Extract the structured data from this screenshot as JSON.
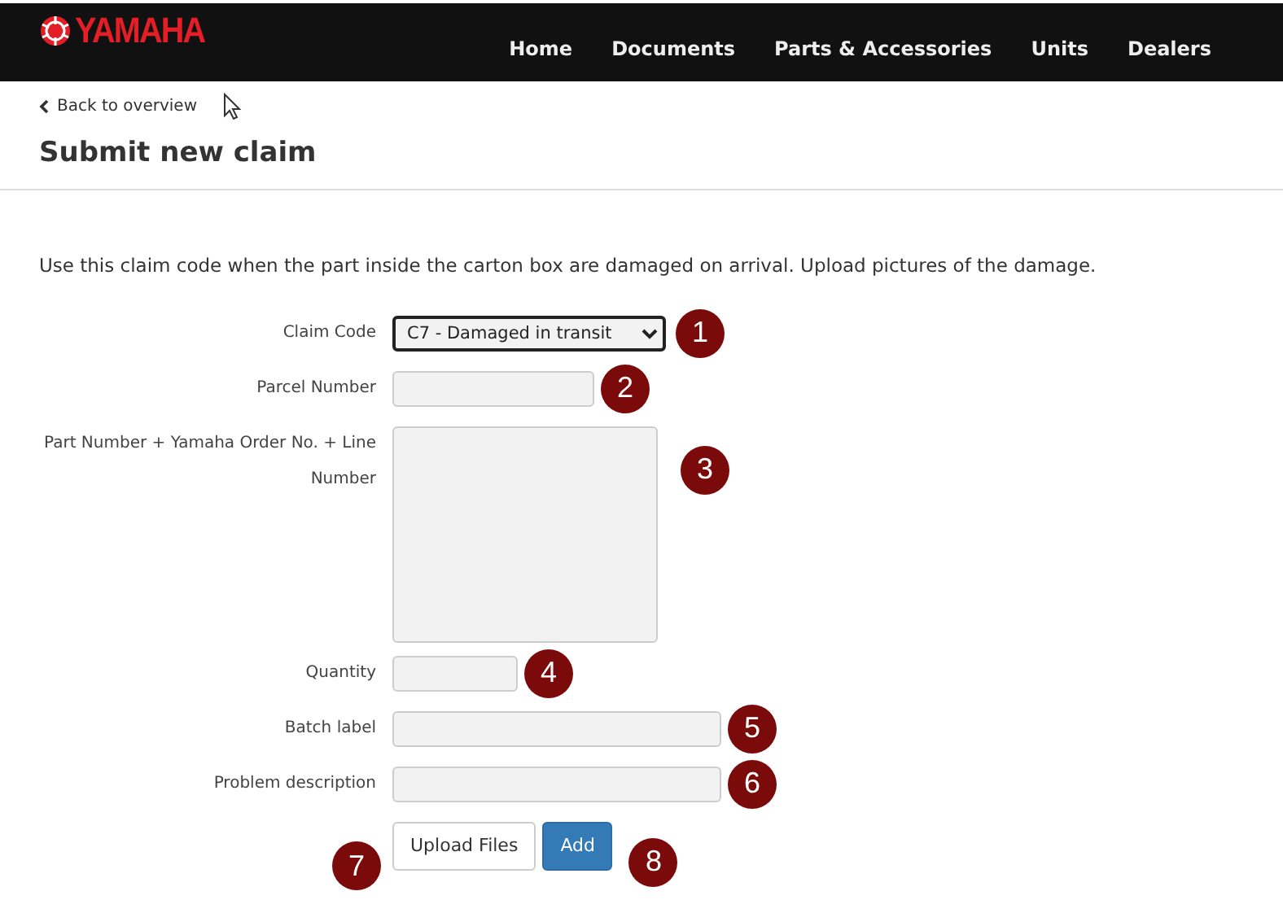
{
  "brand": {
    "name": "YAMAHA"
  },
  "nav": [
    {
      "label": "Home"
    },
    {
      "label": "Documents"
    },
    {
      "label": "Parts & Accessories"
    },
    {
      "label": "Units"
    },
    {
      "label": "Dealers"
    }
  ],
  "back_link": {
    "label": "Back to overview"
  },
  "page_title": "Submit new claim",
  "description": "Use this claim code when the part inside the carton box are damaged on arrival. Upload pictures of the damage.",
  "fields": [
    {
      "label": "Claim Code",
      "kind": "select",
      "value": "C7 - Damaged in transit",
      "marker": "1"
    },
    {
      "label": "Parcel Number",
      "kind": "code",
      "marker": "2"
    },
    {
      "label": "Part Number + Yamaha Order No. + Line Number",
      "kind": "textarea",
      "marker": "3"
    },
    {
      "label": "Quantity",
      "kind": "number",
      "marker": "4"
    },
    {
      "label": "Batch label",
      "kind": "text",
      "marker": "5"
    },
    {
      "label": "Problem description",
      "kind": "text",
      "marker": "6"
    }
  ],
  "buttons": [
    {
      "label": "Upload Files",
      "kind": "secondary",
      "marker": "7"
    },
    {
      "label": "Add",
      "kind": "primary",
      "marker": "8"
    }
  ]
}
